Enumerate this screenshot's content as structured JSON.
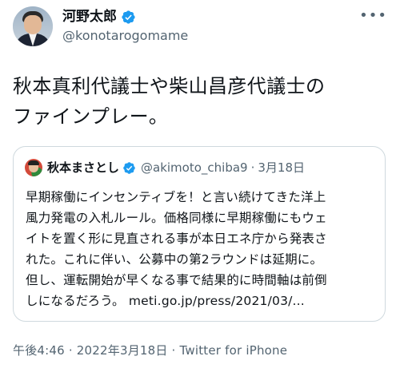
{
  "author": {
    "name": "河野太郎",
    "handle": "@konotarogomame"
  },
  "tweet": {
    "text": "秋本真利代議士や柴山昌彦代議士の\nファインプレー。"
  },
  "quoted": {
    "name": "秋本まさとし",
    "handle": "@akimoto_chiba9",
    "separator": "·",
    "date": "3月18日",
    "text": "早期稼働にインセンティブを！と言い続けてきた洋上\n風力発電の入札ルール。価格同様に早期稼働にもウェ\nイトを置く形に見直される事が本日エネ庁から発表さ\nれた。これに伴い、公募中の第2ラウンドは延期に。\n但し、運転開始が早くなる事で結果的に時間軸は前倒\nしになるだろう。 meti.go.jp/press/2021/03/..."
  },
  "footer": {
    "text": "午後4:46 · 2022年3月18日 · Twitter for iPhone"
  },
  "colors": {
    "verified": "#1d9bf0",
    "secondary_text": "#536471",
    "border": "#cfd9de"
  },
  "icons": {
    "verified": "verified-badge-icon",
    "more": "more-options-icon"
  }
}
